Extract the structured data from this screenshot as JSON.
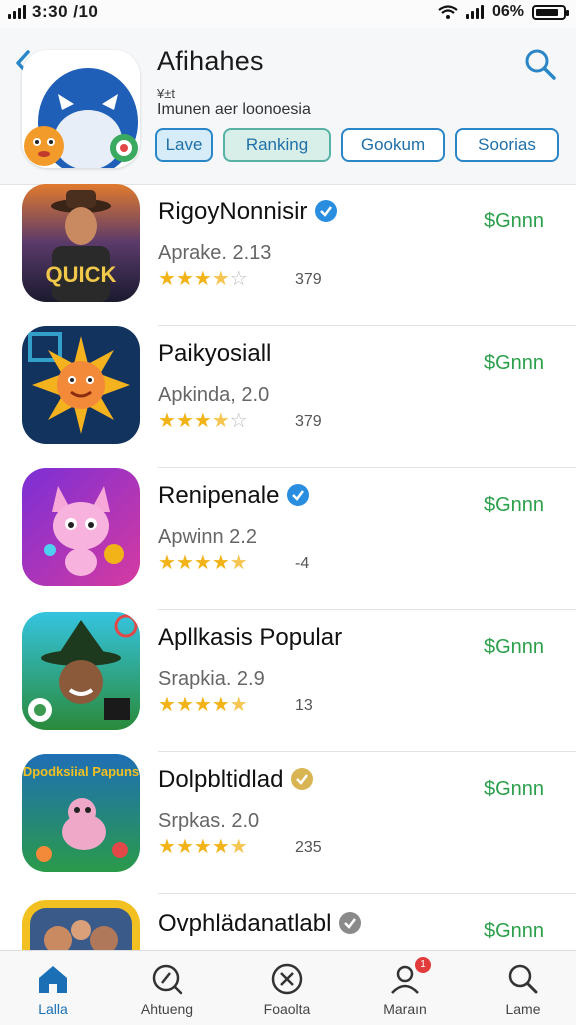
{
  "status_bar": {
    "time": "3:30 /10",
    "battery": "06%",
    "battery_level": 0.85
  },
  "header": {
    "title": "Afihahes",
    "subtitle_small": "¥±t",
    "subtitle": "Imunen aer loonoesia",
    "icon": "penguin-mascot-app-icon",
    "tabs": [
      "Lave",
      "Ranking",
      "Gookum",
      "Soorias"
    ]
  },
  "apps": [
    {
      "name": "RigoyNonnisir",
      "verified": "blue",
      "subtitle": "Aprake. 2.13",
      "rating": 3.5,
      "count": "379",
      "price": "$Gnnn",
      "icon": "cowboy-quick-game-icon",
      "icon_text": "QUICK"
    },
    {
      "name": "Paikyosiall",
      "verified": "",
      "subtitle": "Apkinda, 2.0",
      "rating": 3.5,
      "count": "379",
      "price": "$Gnnn",
      "icon": "sun-face-game-icon"
    },
    {
      "name": "Renipenale",
      "verified": "blue",
      "subtitle": "Apwinn 2.2",
      "rating": 4.5,
      "count": "-4",
      "price": "$Gnnn",
      "icon": "pink-creature-game-icon"
    },
    {
      "name": "Apllkasis Popular",
      "verified": "",
      "subtitle": "Srapkia. 2.9",
      "rating": 4.5,
      "count": "13",
      "price": "$Gnnn",
      "icon": "witch-hat-game-icon"
    },
    {
      "name": "Dolpbltidlad",
      "verified": "gold",
      "subtitle": "Srpkas. 2.0",
      "rating": 4.5,
      "count": "235",
      "price": "$Gnnn",
      "icon": "dragon-poppins-game-icon",
      "icon_text": "Dpodksiial Papuns"
    },
    {
      "name": "Ovphlädanatlabl",
      "verified": "gray",
      "subtitle": "",
      "rating": 0,
      "count": "",
      "price": "$Gnnn",
      "icon": "family-photo-app-icon"
    }
  ],
  "bottom_nav": [
    {
      "label": "Lalla",
      "icon": "home-icon",
      "active": true
    },
    {
      "label": "Ahtueng",
      "icon": "compass-icon",
      "active": false
    },
    {
      "label": "Foaolta",
      "icon": "circle-x-icon",
      "active": false
    },
    {
      "label": "Maraın",
      "icon": "user-icon",
      "active": false,
      "badge": "1"
    },
    {
      "label": "Lame",
      "icon": "search-icon",
      "active": false
    }
  ],
  "colors": {
    "accent": "#2a86c7",
    "price": "#2ba04b",
    "star": "#f2b318",
    "verified_blue": "#2a8ee0",
    "verified_gold": "#d9b452",
    "verified_gray": "#8a8a8a"
  }
}
